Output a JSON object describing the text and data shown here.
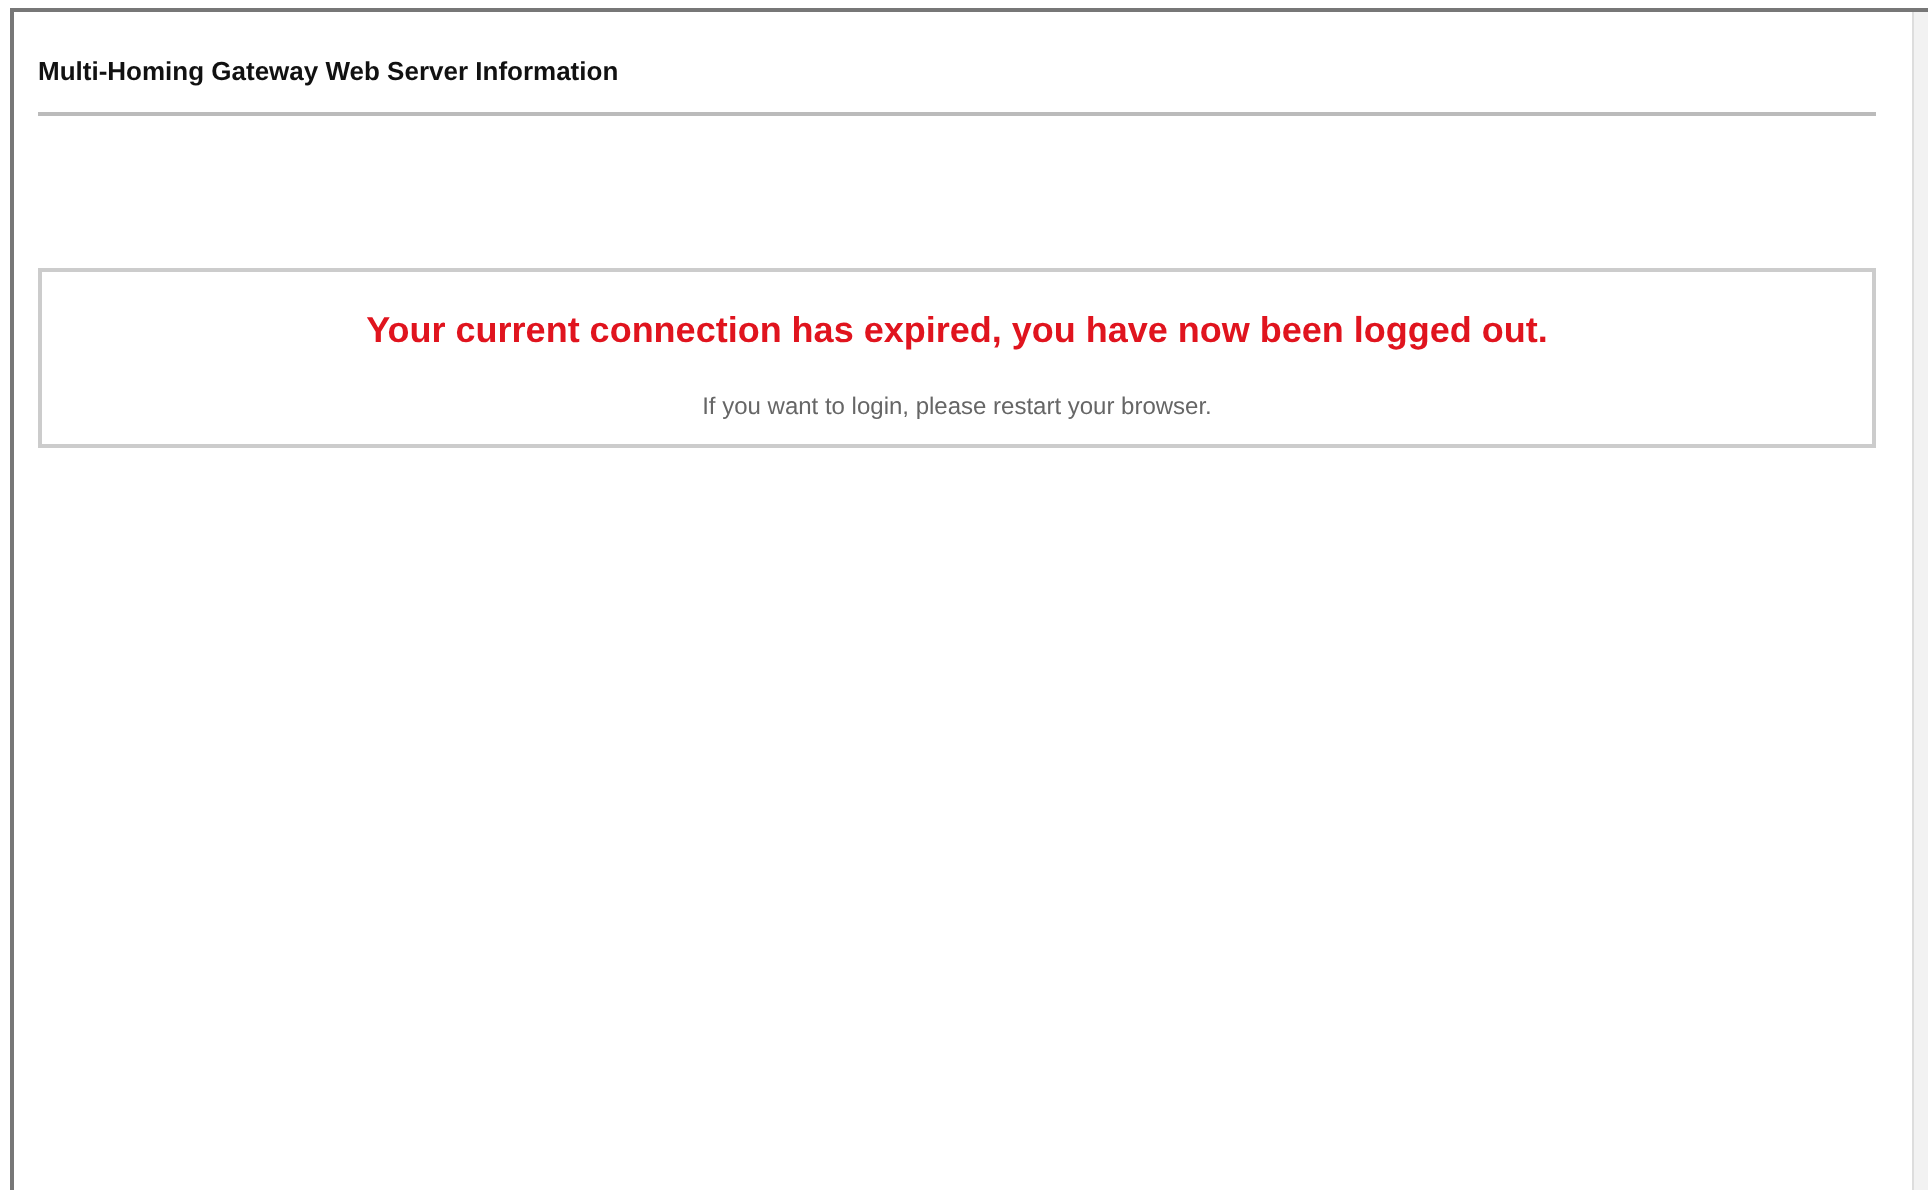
{
  "page": {
    "title": "Multi-Homing Gateway Web Server Information"
  },
  "notice": {
    "headline": "Your current connection has expired, you have now been logged out.",
    "message": "If you want to login, please restart your browser."
  }
}
